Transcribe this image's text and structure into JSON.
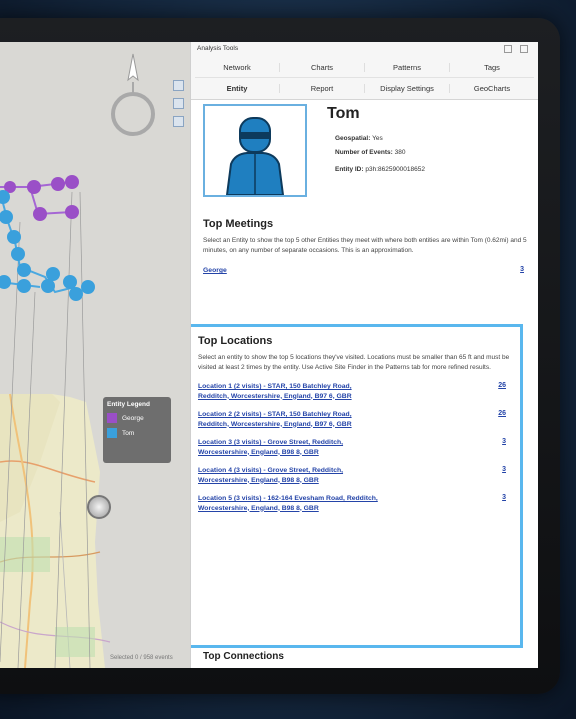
{
  "panel": {
    "title": "Analysis Tools",
    "tabs_row1": [
      "Network",
      "Charts",
      "Patterns",
      "Tags"
    ],
    "tabs_row2": [
      "Entity",
      "Report",
      "Display Settings",
      "GeoCharts"
    ],
    "active_tab": "Entity"
  },
  "entity": {
    "name": "Tom",
    "geospatial_label": "Geospatial:",
    "geospatial_value": "Yes",
    "events_label": "Number of Events:",
    "events_value": "380",
    "id_label": "Entity ID:",
    "id_value": "p3h:8625900018652"
  },
  "meetings": {
    "title": "Top Meetings",
    "description": "Select an Entity to show the top 5 other Entities they meet with where both entities are within Tom (0.62mi) and 5 minutes, on any number of separate occasions. This is an approximation.",
    "items": [
      {
        "name": "George",
        "count": "3"
      }
    ]
  },
  "locations": {
    "title": "Top Locations",
    "description": "Select an entity to show the top 5 locations they've visited. Locations must be smaller than 65 ft and must be visited at least 2 times by the entity. Use Active Site Finder in the Patterns tab for more refined results.",
    "items": [
      {
        "label": "Location 1 (2 visits) - STAR, 150 Batchley Road, Redditch, Worcestershire, England, B97 6, GBR",
        "count": "26"
      },
      {
        "label": "Location 2 (2 visits) - STAR, 150 Batchley Road, Redditch, Worcestershire, England, B97 6, GBR",
        "count": "26"
      },
      {
        "label": "Location 3 (3 visits) - Grove Street, Redditch, Worcestershire, England, B98 8, GBR",
        "count": "3"
      },
      {
        "label": "Location 4 (3 visits) - Grove Street, Redditch, Worcestershire, England, B98 8, GBR",
        "count": "3"
      },
      {
        "label": "Location 5 (3 visits) - 162-164 Evesham Road, Redditch, Worcestershire, England, B98 8, GBR",
        "count": "3"
      }
    ]
  },
  "connections": {
    "title": "Top Connections"
  },
  "legend": {
    "title": "Entity Legend",
    "items": [
      {
        "name": "George",
        "color": "#9a4fc7"
      },
      {
        "name": "Tom",
        "color": "#3aa0dc"
      }
    ]
  },
  "map_status": "Selected 0 / 958 events",
  "icons": [
    "compass-icon",
    "person-avatar-icon",
    "pan-control-icon",
    "minimize-icon",
    "close-icon"
  ]
}
